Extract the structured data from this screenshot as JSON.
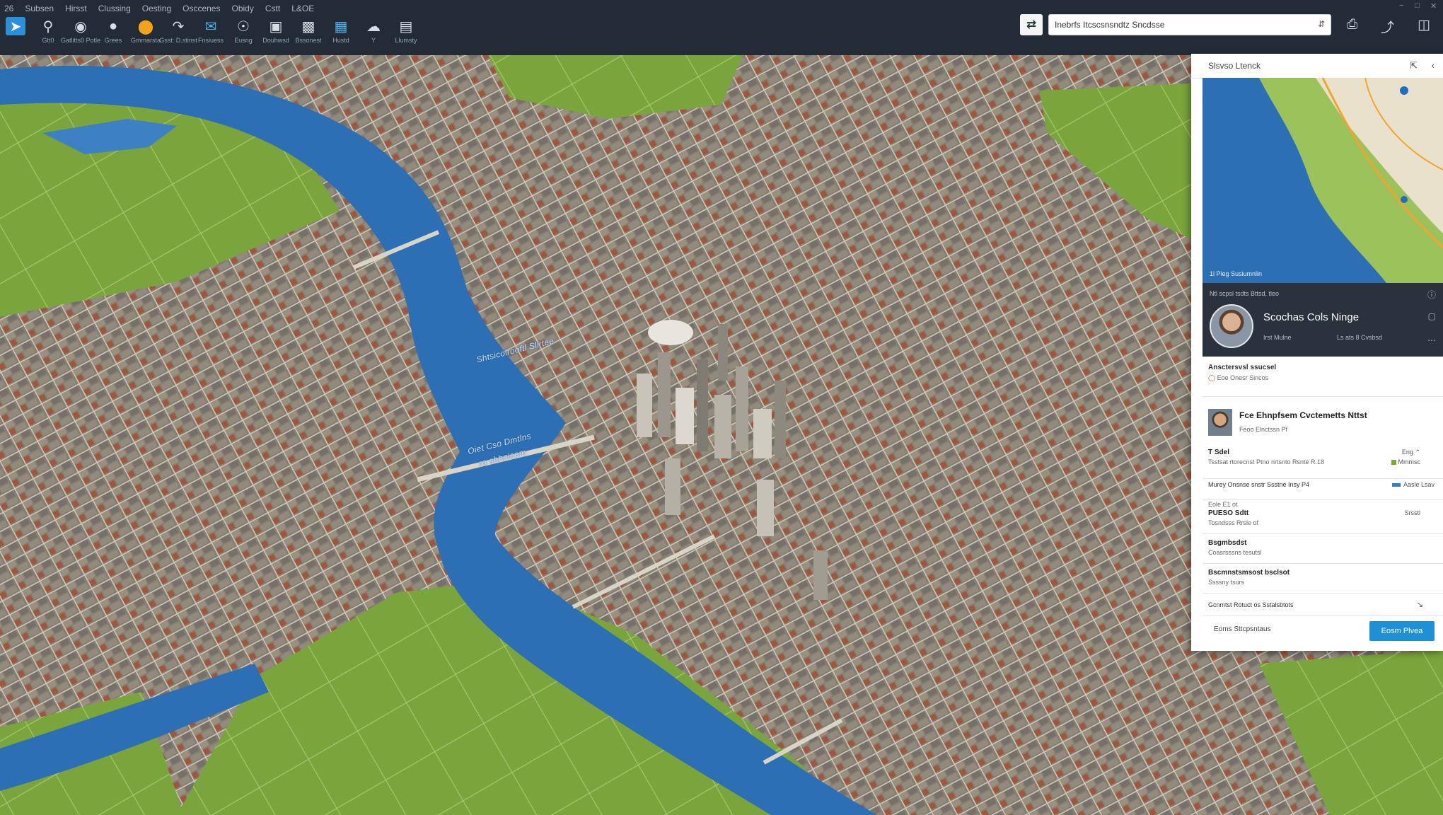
{
  "menu": [
    "26",
    "Subsen",
    "Hirsst",
    "Clussing",
    "Oesting",
    "Osccenes",
    "Obidy",
    "Cstt",
    "L&OE"
  ],
  "toolbar": [
    {
      "icon": "app-logo-icon",
      "label": "",
      "active": true
    },
    {
      "icon": "pin-icon",
      "label": "Gtt0"
    },
    {
      "icon": "binoculars-icon",
      "label": "Gatlitts0 Potle"
    },
    {
      "icon": "location-icon",
      "label": "Grees"
    },
    {
      "icon": "circle-layer-icon",
      "label": "Gmmarsta"
    },
    {
      "icon": "measure-icon",
      "label": "Gsst: D.stinst"
    },
    {
      "icon": "bubble-icon",
      "label": "Fnsiuess"
    },
    {
      "icon": "compass-icon",
      "label": "Eusng"
    },
    {
      "icon": "building-icon",
      "label": "Douhwsd"
    },
    {
      "icon": "layers-icon",
      "label": "Bssonest"
    },
    {
      "icon": "photo-icon",
      "label": "Hustd"
    },
    {
      "icon": "cloud-icon",
      "label": "Y"
    },
    {
      "icon": "grid-icon",
      "label": "Llumsty"
    }
  ],
  "search": {
    "value": "Inebrfs Itcscsnsndtz Sncdsse",
    "placeholder": "Search"
  },
  "map_labels": [
    "Shtsicolrooftl Slirtee",
    "Oiet Cso Dmtlns",
    "ro shhnicem"
  ],
  "panel": {
    "title": "Slsvso Ltenck",
    "mini_caption": "1l Pleg Susiumnlin",
    "profile": {
      "subhead": "Ntl scpsl tsdts Bttsd, tleo",
      "name": "Scochas Cols Ninge",
      "meta1": "Irst Mulne",
      "meta2": "Ls ats 8 Cvsbsd"
    },
    "section1": {
      "title": "Ansctersvsl ssucsel",
      "sub": "Eoe Onesr Sincos"
    },
    "card": {
      "title": "Fce Ehnpfsem Cvctemetts Nttst",
      "sub": "Feoo Elnctssn Pf"
    },
    "rows": [
      {
        "title": "T Sdel",
        "sub": "Tsstsat rtorecnst Ptno nrtsnto Rsnte R.18",
        "val1": "Eng",
        "val2": "Mmmsc"
      },
      {
        "title": "Murey Onsnse snstr Ssstne Insy P4",
        "sub": "",
        "val1": "",
        "val2": "Aasle Lsav"
      },
      {
        "title": "PUESO Sdtt",
        "sub": "Tosndsss Rrsle of",
        "pre": "Eole E1 ot",
        "val1": "Srsstl",
        "val2": ""
      },
      {
        "title": "Bsgmbsdst",
        "sub": "Coasrsssns tesutsl",
        "val1": "",
        "val2": ""
      },
      {
        "title": "Bscmnstsmsost bsclsot",
        "sub": "Ssssny tsurs",
        "val1": "",
        "val2": ""
      },
      {
        "title": "Gcnmtst Rotuct os Sstalsbtots",
        "sub": "",
        "val1": "",
        "val2": ""
      }
    ],
    "footer_link": "Eoms Sttcpsntaus",
    "primary_button": "Eosm Plvea"
  },
  "colors": {
    "water": "#2c6fb4",
    "park": "#79a23d",
    "city": "#8a8478",
    "toolbar": "#232b36",
    "accent": "#1f8fd6"
  }
}
